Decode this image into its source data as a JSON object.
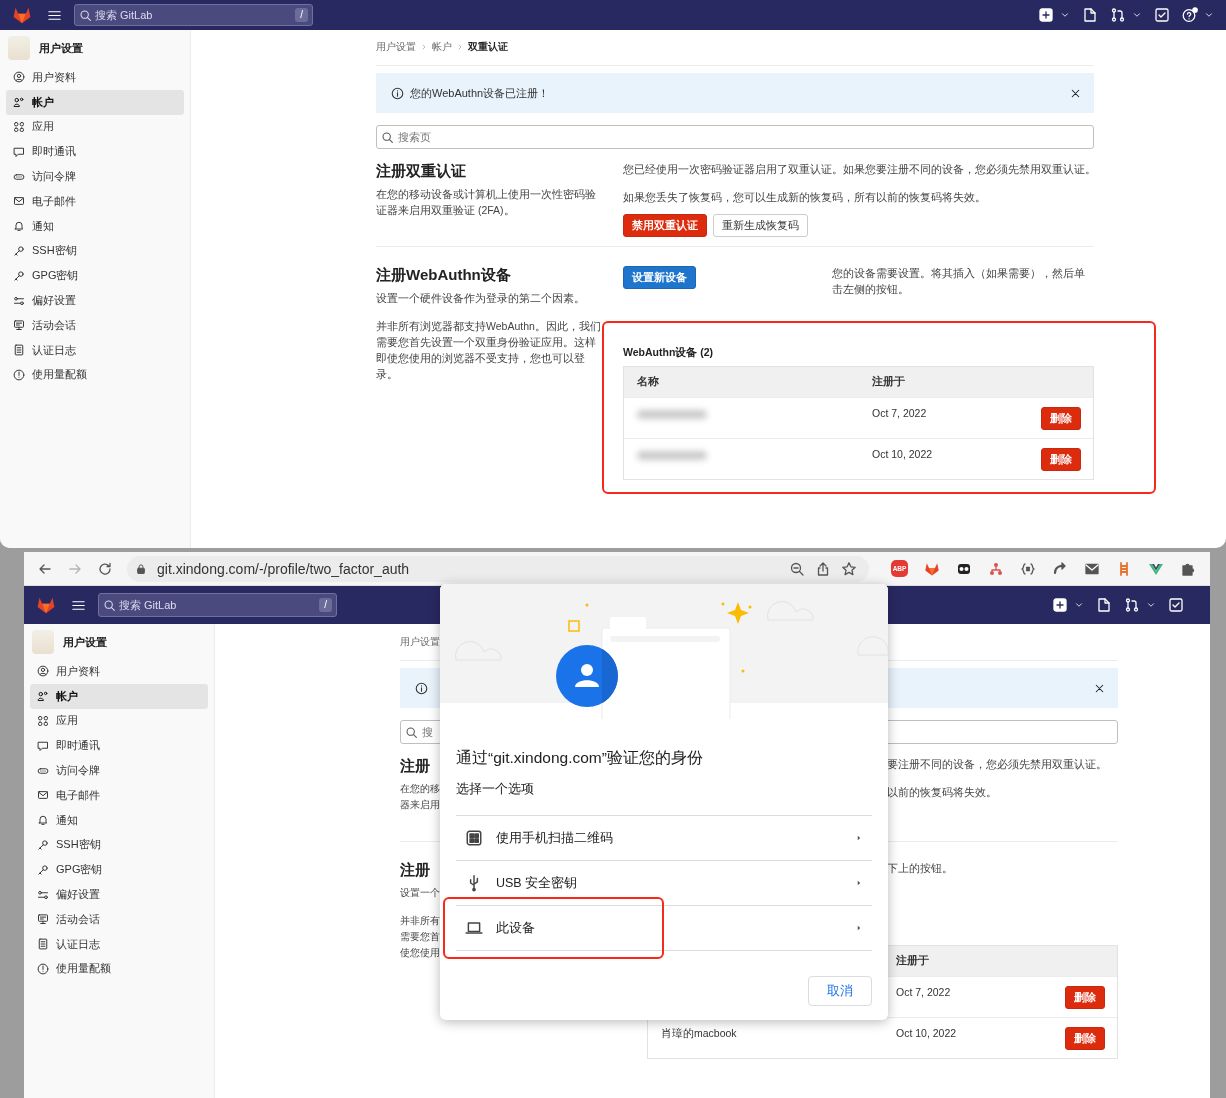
{
  "top_screen": {
    "header": {
      "search": {
        "placeholder": "搜索 GitLab",
        "shortcut": "/"
      }
    },
    "sidebar": {
      "title": "用户设置",
      "items": [
        {
          "label": "用户资料",
          "selected": false
        },
        {
          "label": "帐户",
          "selected": true
        },
        {
          "label": "应用",
          "selected": false
        },
        {
          "label": "即时通讯",
          "selected": false
        },
        {
          "label": "访问令牌",
          "selected": false
        },
        {
          "label": "电子邮件",
          "selected": false
        },
        {
          "label": "通知",
          "selected": false
        },
        {
          "label": "SSH密钥",
          "selected": false
        },
        {
          "label": "GPG密钥",
          "selected": false
        },
        {
          "label": "偏好设置",
          "selected": false
        },
        {
          "label": "活动会话",
          "selected": false
        },
        {
          "label": "认证日志",
          "selected": false
        },
        {
          "label": "使用量配额",
          "selected": false
        }
      ]
    },
    "breadcrumb": [
      "用户设置",
      "帐户",
      "双重认证"
    ],
    "alert": {
      "kind": "info",
      "text": "您的WebAuthn设备已注册！"
    },
    "search": {
      "placeholder": "搜索页"
    },
    "two_factor": {
      "title": "注册双重认证",
      "description": [
        "在您的移动设备或计算机上使用一次性密码验证器来启用双重验证 (2FA)。"
      ],
      "notes": [
        "您已经使用一次密码验证器启用了双重认证。如果您要注册不同的设备，您必须先禁用双重认证。",
        "如果您丢失了恢复码，您可以生成新的恢复码，所有以前的恢复码将失效。"
      ],
      "buttons": [
        {
          "label": "禁用双重认证",
          "kind": "danger"
        },
        {
          "label": "重新生成恢复码",
          "kind": "default"
        }
      ]
    },
    "webauthn": {
      "title": "注册WebAuthn设备",
      "description": [
        "设置一个硬件设备作为登录的第二个因素。"
      ],
      "note": [
        "并非所有浏览器都支持WebAuthn。因此，我们需要您首先设置一个双重身份验证应用。这样即使您使用的浏览器不受支持，您也可以登录。"
      ],
      "button": "设置新设备",
      "hint": "您的设备需要设置。将其插入（如果需要），然后单击左侧的按钮。",
      "devices": {
        "title": "WebAuthn设备 (2)",
        "highlighted": true,
        "columns": [
          "名称",
          "注册于"
        ],
        "rows": [
          {
            "redacted": true,
            "date": "Oct 7, 2022",
            "action": "删除"
          },
          {
            "redacted": true,
            "date": "Oct 10, 2022",
            "action": "删除"
          }
        ]
      }
    }
  },
  "bottom_screen": {
    "browser": {
      "url": "git.xindong.com/-/profile/two_factor_auth",
      "badge": "ABP"
    },
    "header": {
      "search": {
        "placeholder": "搜索 GitLab",
        "shortcut": "/"
      }
    },
    "sidebar": {
      "title": "用户设置",
      "items": [
        {
          "label": "用户资料",
          "selected": false
        },
        {
          "label": "帐户",
          "selected": true
        },
        {
          "label": "应用",
          "selected": false
        },
        {
          "label": "即时通讯",
          "selected": false
        },
        {
          "label": "访问令牌",
          "selected": false
        },
        {
          "label": "电子邮件",
          "selected": false
        },
        {
          "label": "通知",
          "selected": false
        },
        {
          "label": "SSH密钥",
          "selected": false
        },
        {
          "label": "GPG密钥",
          "selected": false
        },
        {
          "label": "偏好设置",
          "selected": false
        },
        {
          "label": "活动会话",
          "selected": false
        },
        {
          "label": "认证日志",
          "selected": false
        },
        {
          "label": "使用量配额",
          "selected": false
        }
      ]
    },
    "breadcrumb": [
      "用户设置"
    ],
    "alert": {
      "kind": "info"
    },
    "search": {
      "placeholder": "搜"
    },
    "two_factor": {
      "title": "注册",
      "description": [
        "在您的移",
        "器来启用"
      ],
      "notes": [
        "要注册不同的设备，您必须先禁用双重认证。",
        "以前的恢复码将失效。"
      ]
    },
    "webauthn": {
      "title": "注册",
      "description": [
        "设置一个"
      ],
      "note": [
        "并非所有",
        "需要您首",
        "使您使用"
      ],
      "hint": "下上的按钮。",
      "devices": {
        "columns": [
          "注册于"
        ],
        "rows": [
          {
            "date": "Oct 7, 2022",
            "action": "删除"
          },
          {
            "name": "肖璋的macbook",
            "date": "Oct 10, 2022",
            "action": "删除"
          }
        ]
      }
    },
    "dialog": {
      "title": "通过“git.xindong.com”验证您的身份",
      "subtitle": "选择一个选项",
      "options": [
        {
          "label": "使用手机扫描二维码",
          "highlighted": false
        },
        {
          "label": "USB 安全密钥",
          "highlighted": false
        },
        {
          "label": "此设备",
          "highlighted": true
        }
      ],
      "cancel": "取消"
    }
  }
}
